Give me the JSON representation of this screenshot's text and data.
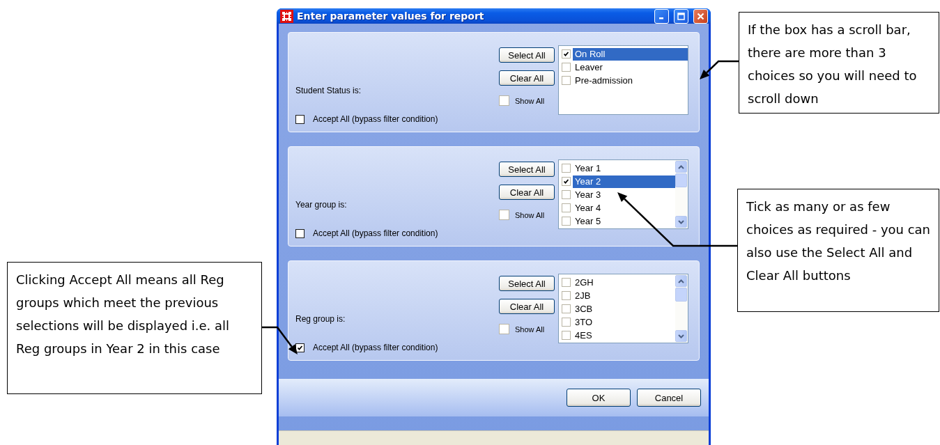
{
  "window": {
    "title": "Enter parameter values for report"
  },
  "filters": [
    {
      "label": "Student Status is:",
      "select_all": "Select All",
      "clear_all": "Clear All",
      "show_all": {
        "label": "Show All",
        "checked": false
      },
      "accept_all": {
        "label": "Accept All (bypass filter condition)",
        "checked": false
      },
      "scrollbar": false,
      "options": [
        {
          "label": "On Roll",
          "checked": true,
          "selected": true
        },
        {
          "label": "Leaver",
          "checked": false,
          "selected": false
        },
        {
          "label": "Pre-admission",
          "checked": false,
          "selected": false
        }
      ]
    },
    {
      "label": "Year group is:",
      "select_all": "Select All",
      "clear_all": "Clear All",
      "show_all": {
        "label": "Show All",
        "checked": false
      },
      "accept_all": {
        "label": "Accept All (bypass filter condition)",
        "checked": false
      },
      "scrollbar": true,
      "options": [
        {
          "label": "Year 1",
          "checked": false,
          "selected": false
        },
        {
          "label": "Year 2",
          "checked": true,
          "selected": true
        },
        {
          "label": "Year 3",
          "checked": false,
          "selected": false
        },
        {
          "label": "Year 4",
          "checked": false,
          "selected": false
        },
        {
          "label": "Year 5",
          "checked": false,
          "selected": false
        }
      ]
    },
    {
      "label": "Reg group is:",
      "select_all": "Select All",
      "clear_all": "Clear All",
      "show_all": {
        "label": "Show All",
        "checked": false
      },
      "accept_all": {
        "label": "Accept All (bypass filter condition)",
        "checked": true
      },
      "scrollbar": true,
      "options": [
        {
          "label": "2GH",
          "checked": false,
          "selected": false
        },
        {
          "label": "2JB",
          "checked": false,
          "selected": false
        },
        {
          "label": "3CB",
          "checked": false,
          "selected": false
        },
        {
          "label": "3TO",
          "checked": false,
          "selected": false
        },
        {
          "label": "4ES",
          "checked": false,
          "selected": false
        }
      ]
    }
  ],
  "buttons": [
    "OK",
    "Cancel"
  ],
  "callouts": [
    {
      "text": "If the box has a scroll bar, there are more than 3 choices so you will need to scroll down"
    },
    {
      "text": "Tick as many or as few choices as required - you can also use the Select All and Clear All buttons"
    },
    {
      "text": "Clicking Accept All means all Reg groups which meet the previous selections will be displayed i.e. all Reg groups in Year 2 in this case"
    }
  ]
}
